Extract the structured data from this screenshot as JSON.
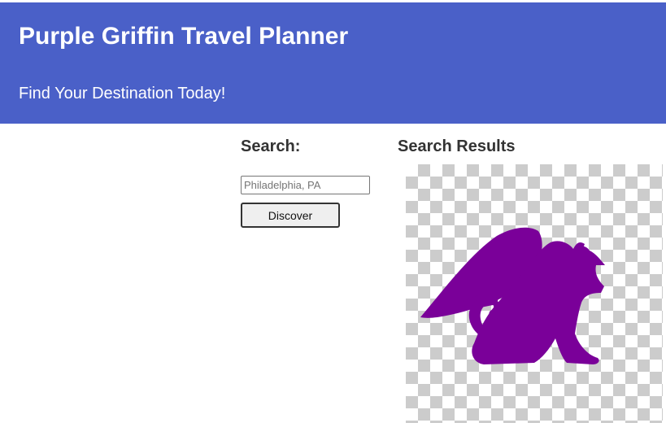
{
  "header": {
    "title": "Purple Griffin Travel Planner",
    "tagline": "Find Your Destination Today!",
    "background_color": "#4a60c8"
  },
  "search": {
    "heading": "Search:",
    "placeholder": "Philadelphia, PA",
    "value": "",
    "button_label": "Discover"
  },
  "results": {
    "heading": "Search Results",
    "image": {
      "subject": "purple-griffin-silhouette",
      "background": "transparency-checkerboard",
      "color": "#7a0099"
    }
  }
}
